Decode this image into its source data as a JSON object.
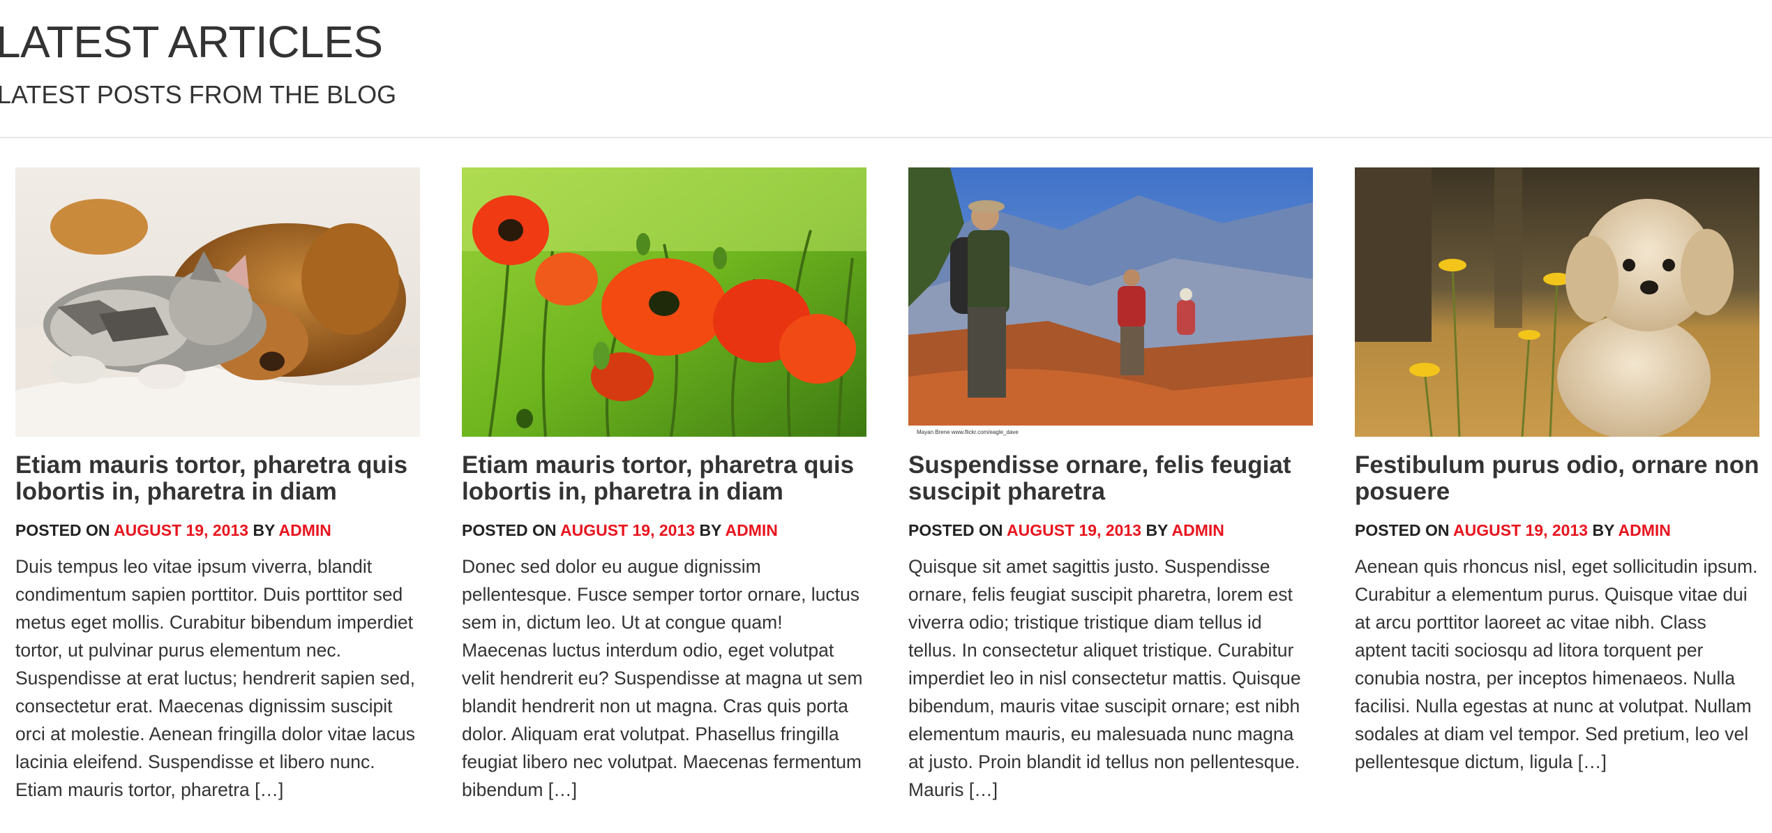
{
  "section": {
    "title": "LATEST ARTICLES",
    "subtitle": "LATEST POSTS FROM THE BLOG"
  },
  "meta_labels": {
    "posted_on": "POSTED ON",
    "by": "BY"
  },
  "articles": [
    {
      "image": "kitten-and-puppy-photo",
      "title": "Etiam mauris tortor, pharetra quis lobortis in, pharetra in diam",
      "date": "AUGUST 19, 2013",
      "author": "ADMIN",
      "excerpt": "Duis tempus leo vitae ipsum viverra, blandit condimentum sapien porttitor. Duis porttitor sed metus eget mollis. Curabitur bibendum imperdiet tortor, ut pulvinar purus elementum nec. Suspendisse at erat luctus; hendrerit sapien sed, consectetur erat. Maecenas dignissim suscipit orci at molestie. Aenean fringilla dolor vitae lacus lacinia eleifend. Suspendisse et libero nunc. Etiam mauris tortor, pharetra […]"
    },
    {
      "image": "red-poppies-photo",
      "title": "Etiam mauris tortor, pharetra quis lobortis in, pharetra in diam",
      "date": "AUGUST 19, 2013",
      "author": "ADMIN",
      "excerpt": "Donec sed dolor eu augue dignissim pellentesque. Fusce semper tortor ornare, luctus sem in, dictum leo. Ut at congue quam! Maecenas luctus interdum odio, eget volutpat velit hendrerit eu? Suspendisse at magna ut sem blandit hendrerit non ut magna. Cras quis porta dolor. Aliquam erat volutpat. Phasellus fringilla feugiat libero nec volutpat. Maecenas fermentum bibendum […]"
    },
    {
      "image": "canyon-hikers-photo",
      "image_caption": "Mayan Brene        www.flickr.com/eagle_dave",
      "title": "Suspendisse ornare, felis feugiat suscipit pharetra",
      "date": "AUGUST 19, 2013",
      "author": "ADMIN",
      "excerpt": "Quisque sit amet sagittis justo. Suspendisse ornare, felis feugiat suscipit pharetra, lorem est viverra odio; tristique tristique diam tellus id tellus. In consectetur aliquet tristique. Curabitur imperdiet leo in nisl consectetur mattis. Quisque bibendum, mauris vitae suscipit ornare; est nibh elementum mauris, eu malesuada nunc magna at justo. Proin blandit id tellus non pellentesque. Mauris […]"
    },
    {
      "image": "fluffy-puppy-in-field-photo",
      "title": "Festibulum purus odio, ornare non posuere",
      "date": "AUGUST 19, 2013",
      "author": "ADMIN",
      "excerpt": "Aenean quis rhoncus nisl, eget sollicitudin ipsum. Curabitur a elementum purus. Quisque vitae dui at arcu porttitor laoreet ac vitae nibh. Class aptent taciti sociosqu ad litora torquent per conubia nostra, per inceptos himenaeos. Nulla facilisi. Nulla egestas at nunc at volutpat. Nullam sodales at diam vel tempor. Sed pretium, leo vel pellentesque dictum, ligula […]"
    }
  ],
  "colors": {
    "accent": "#e8141e",
    "text": "#333333",
    "divider": "#e6e6e6"
  }
}
